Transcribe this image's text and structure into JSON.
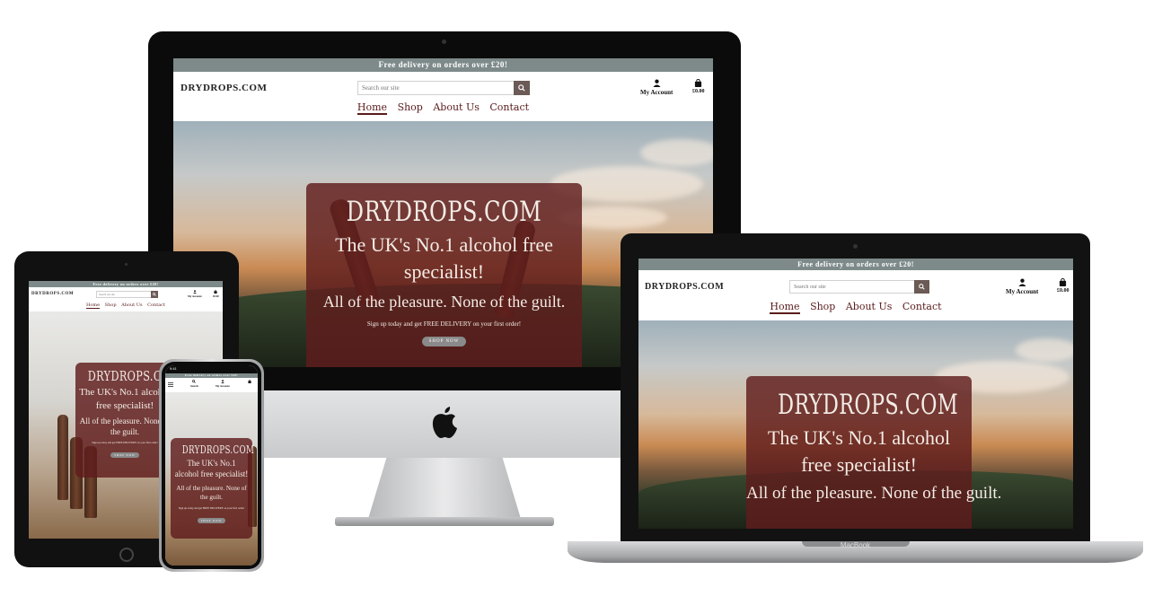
{
  "site": {
    "banner": "Free delivery on orders over £20!",
    "logo": "DRYDROPS.COM",
    "search_placeholder": "Search our site",
    "account_label": "My Account",
    "search_label": "Search",
    "bag_total": "£0.00",
    "nav": [
      "Home",
      "Shop",
      "About Us",
      "Contact"
    ],
    "active_nav": "Home"
  },
  "hero_card": {
    "title": "DRYDROPS.COM",
    "subtitle": "The UK's No.1 alcohol free specialist!",
    "tagline": "All of the pleasure. None of the guilt.",
    "signup": "Sign up today and get FREE DELIVERY on your first order!",
    "button": "SHOP NOW"
  },
  "devices": {
    "laptop_brand": "MacBook",
    "phone_time": "9:41"
  },
  "colors": {
    "banner": "#7e8a8a",
    "card": "#5f1c1c",
    "nav_text": "#5a1b1b",
    "search_button": "#6b5a55"
  },
  "icons": [
    "search-icon",
    "user-icon",
    "shopping-bag-icon",
    "apple-logo-icon",
    "menu-icon"
  ]
}
